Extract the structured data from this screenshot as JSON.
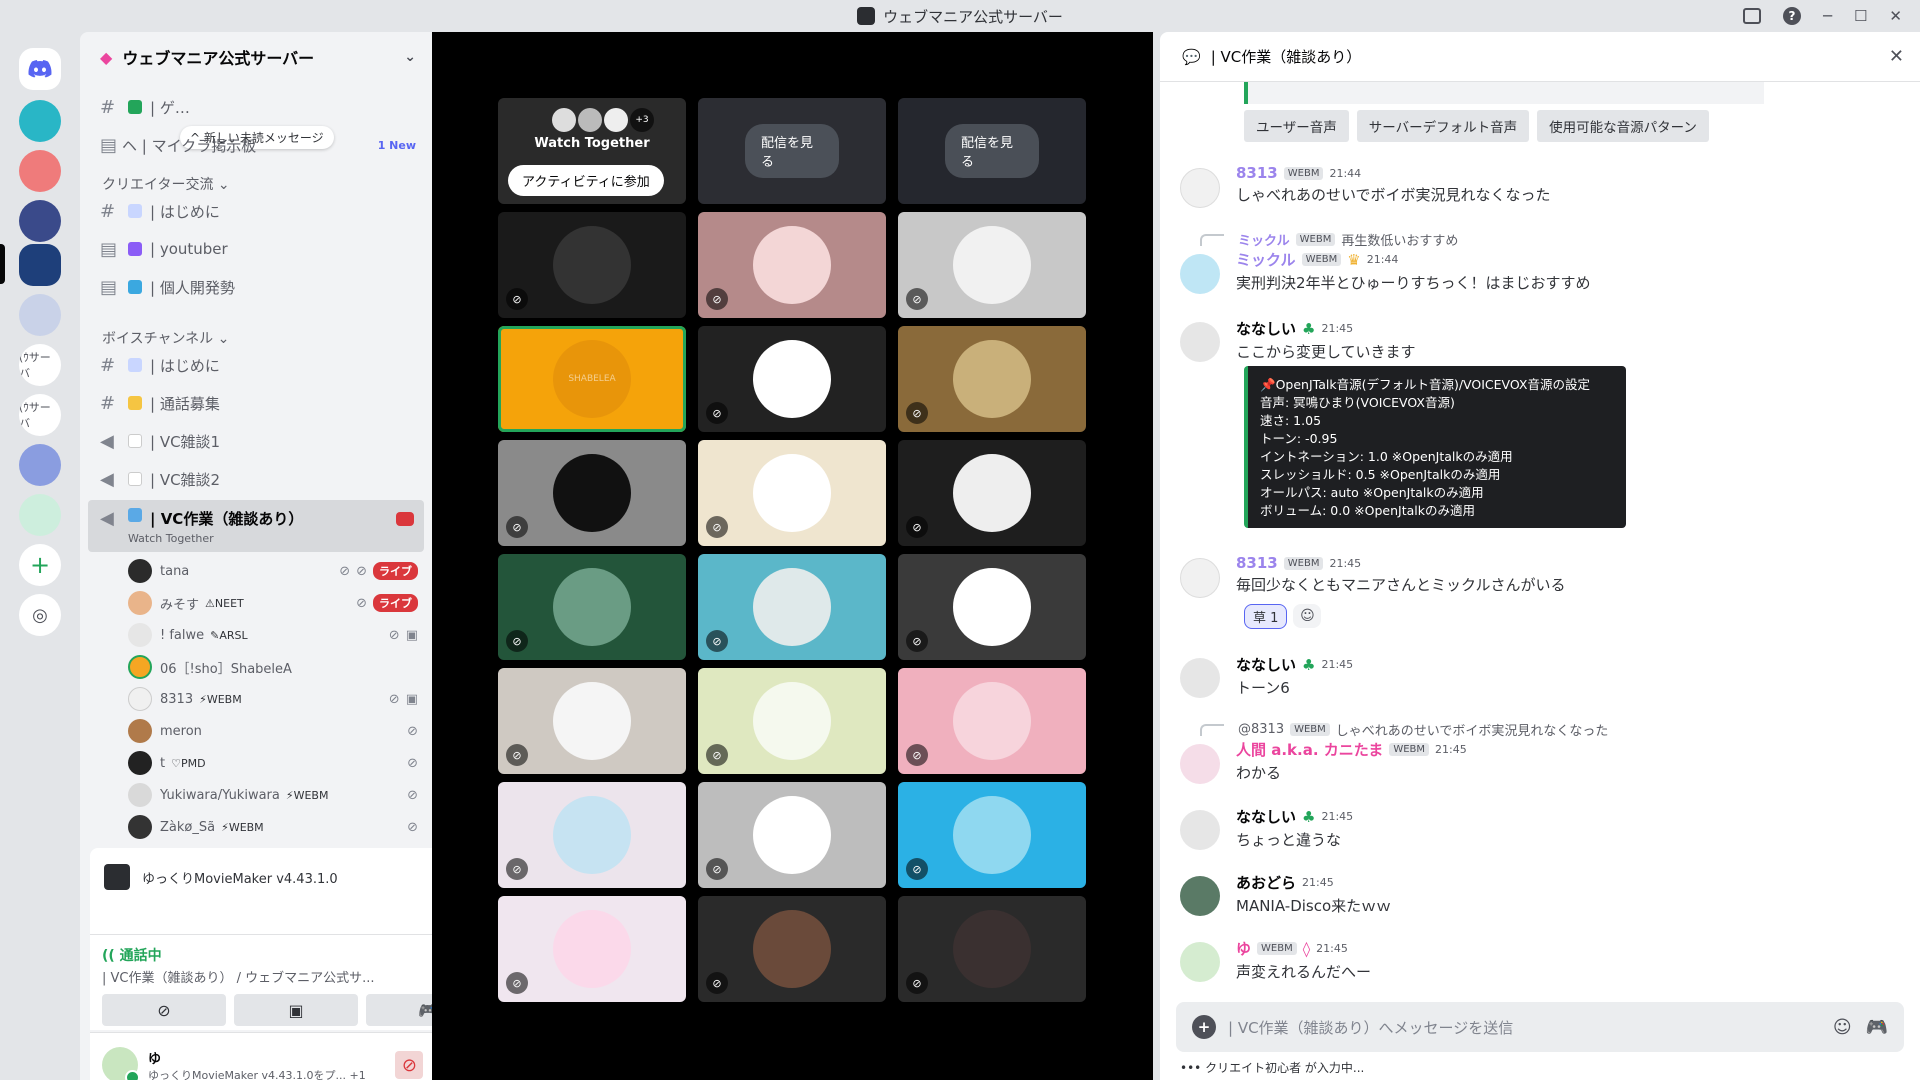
{
  "window": {
    "title": "ウェブマニア公式サーバー"
  },
  "rail": {
    "text_servers": [
      "(ｳサーバ",
      "(ｳサーバ"
    ]
  },
  "sidebar": {
    "server_name": "ウェブマニア公式サーバー",
    "unread_pill": "新しい未読メッセージ",
    "channels_top": [
      {
        "label": "| ゲ…",
        "icon": "hash"
      },
      {
        "label": "ヘ | マイクラ掲示板",
        "icon": "forum",
        "badge": "1 New"
      }
    ],
    "categories": [
      "クリエイター交流",
      "ボイスチャンネル"
    ],
    "creator_channels": [
      {
        "label": "| はじめに",
        "icon": "hash"
      },
      {
        "label": "| youtuber",
        "icon": "forum"
      },
      {
        "label": "| 個人開発勢",
        "icon": "forum"
      }
    ],
    "voice_channels": [
      {
        "label": "| はじめに",
        "icon": "hash"
      },
      {
        "label": "| 通話募集",
        "icon": "hash"
      },
      {
        "label": "| VC雑談1",
        "icon": "speaker"
      },
      {
        "label": "| VC雑談2",
        "icon": "speaker"
      }
    ],
    "active_channel": {
      "label": "| VC作業（雑談あり）",
      "sub": "Watch Together"
    },
    "members": [
      {
        "name": "tana",
        "tag": "",
        "live": "ライブ"
      },
      {
        "name": "みそす",
        "tag": "NEET",
        "live": "ライブ"
      },
      {
        "name": "! falwe",
        "tag": "ARSL",
        "live": ""
      },
      {
        "name": "06［!sho］ShabeleA",
        "tag": "",
        "live": ""
      },
      {
        "name": "8313",
        "tag": "WEBM",
        "live": ""
      },
      {
        "name": "meron",
        "tag": "",
        "live": ""
      },
      {
        "name": "t",
        "tag": "PMD",
        "live": ""
      },
      {
        "name": "Yukiwara/Yukiwara",
        "tag": "WEBM",
        "live": ""
      },
      {
        "name": "Zàkø_Sã",
        "tag": "WEBM",
        "live": ""
      }
    ],
    "activity": "ゆっくりMovieMaker v4.43.1.0",
    "voice_status": "通話中",
    "voice_channel_line": "| VC作業（雑談あり） / ウェブマニア公式サ...",
    "user_name": "ゆ",
    "user_sub": "ゆっくりMovieMaker v4.43.1.0をプ...",
    "user_sub_extra": "+1"
  },
  "stage": {
    "watch_title": "Watch Together",
    "watch_count": "+3",
    "watch_button": "アクティビティに参加",
    "stream_button": "配信を見る",
    "speaking_label": "SHABELEA"
  },
  "chat": {
    "header_title": "| VC作業（雑談あり）",
    "buttons": [
      "ユーザー音声",
      "サーバーデフォルト音声",
      "使用可能な音源パターン"
    ],
    "messages": [
      {
        "name": "8313",
        "badge": "WEBM",
        "time": "21:44",
        "text": "しゃべれあのせいでボイボ実況見れなくなった"
      },
      {
        "reply_name": "ミックル",
        "reply_badge": "WEBM",
        "reply_text": "再生数低いおすすめ",
        "name": "ミックル",
        "badge": "WEBM",
        "time": "21:44",
        "text": "実刑判決2年半とひゅーりすちっく！はまじおすすめ"
      },
      {
        "name": "ななしい",
        "time": "21:45",
        "text": "ここから変更していきます"
      },
      {
        "name": "8313",
        "badge": "WEBM",
        "time": "21:45",
        "text": "毎回少なくともマニアさんとミックルさんがいる"
      },
      {
        "name": "ななしい",
        "time": "21:45",
        "text": "トーン6"
      },
      {
        "reply_name": "@8313",
        "reply_badge": "WEBM",
        "reply_text": "しゃべれあのせいでボイボ実況見れなくなった",
        "name": "人間 a.k.a. カニたま",
        "badge": "WEBM",
        "time": "21:45",
        "text": "わかる"
      },
      {
        "name": "ななしい",
        "time": "21:45",
        "text": "ちょっと違うな"
      },
      {
        "name": "あおどら",
        "time": "21:45",
        "text": "MANIA-Disco来たｗｗ"
      },
      {
        "name": "ゆ",
        "badge": "WEBM",
        "time": "21:45",
        "text": "声変えれるんだへー"
      }
    ],
    "card_lines": [
      "📌OpenJTalk音源(デフォルト音源)/VOICEVOX音源の設定",
      "音声: 冥鳴ひまり(VOICEVOX音源)",
      "速さ: 1.05",
      "トーン: -0.95",
      "イントネーション: 1.0 ※OpenJtalkのみ適用",
      "スレッショルド: 0.5 ※OpenJtalkのみ適用",
      "オールパス: auto ※OpenJtalkのみ適用",
      "ボリューム: 0.0 ※OpenJtalkのみ適用"
    ],
    "reaction": {
      "emoji": "草",
      "count": "1"
    },
    "input_placeholder": "| VC作業（雑談あり）へメッセージを送信",
    "typing": "クリエイト初心者 が入力中..."
  }
}
